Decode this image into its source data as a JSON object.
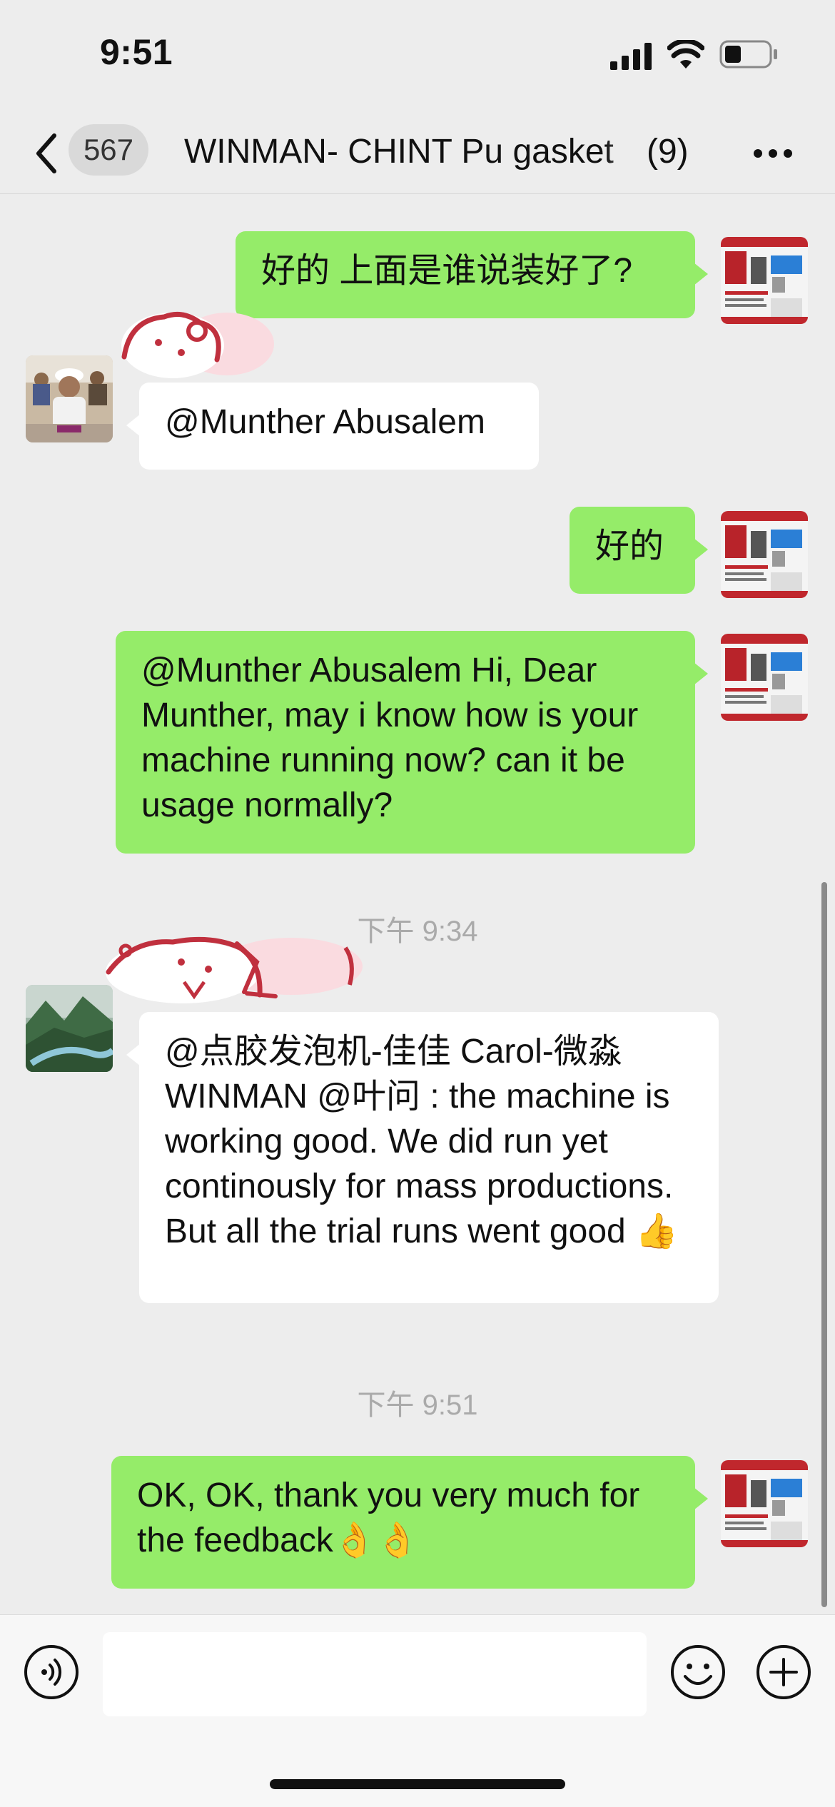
{
  "status_bar": {
    "time": "9:51",
    "icons": [
      "signal-icon",
      "wifi-icon",
      "battery-icon"
    ]
  },
  "header": {
    "back_icon": "chevron-left-icon",
    "unread_count": "567",
    "title": "WINMAN- CHINT Pu gasket",
    "member_count": "(9)",
    "more_icon": "more-horizontal-icon"
  },
  "messages": [
    {
      "direction": "out",
      "text": "好的 上面是谁说装好了?"
    },
    {
      "direction": "in",
      "text": "@Munther Abusalem"
    },
    {
      "direction": "out",
      "text": "好的"
    },
    {
      "direction": "out",
      "text": "@Munther Abusalem Hi, Dear Munther, may i know how is your machine running now? can it be usage normally?"
    },
    {
      "type": "time",
      "text": "下午 9:34"
    },
    {
      "direction": "in",
      "text": "@点胶发泡机-佳佳 Carol-微淼 WINMAN @叶问 : the machine is working good. We did run yet continously for mass productions. But all the trial runs went good 👍"
    },
    {
      "type": "time",
      "text": "下午 9:51"
    },
    {
      "direction": "out",
      "text": "OK, OK, thank you very much for the feedback👌👌"
    }
  ],
  "input_bar": {
    "placeholder": "",
    "icons": [
      "voice-icon",
      "emoji-icon",
      "plus-icon"
    ]
  },
  "colors": {
    "outgoing_bubble": "#95ec69",
    "incoming_bubble": "#ffffff",
    "background": "#ededed"
  }
}
